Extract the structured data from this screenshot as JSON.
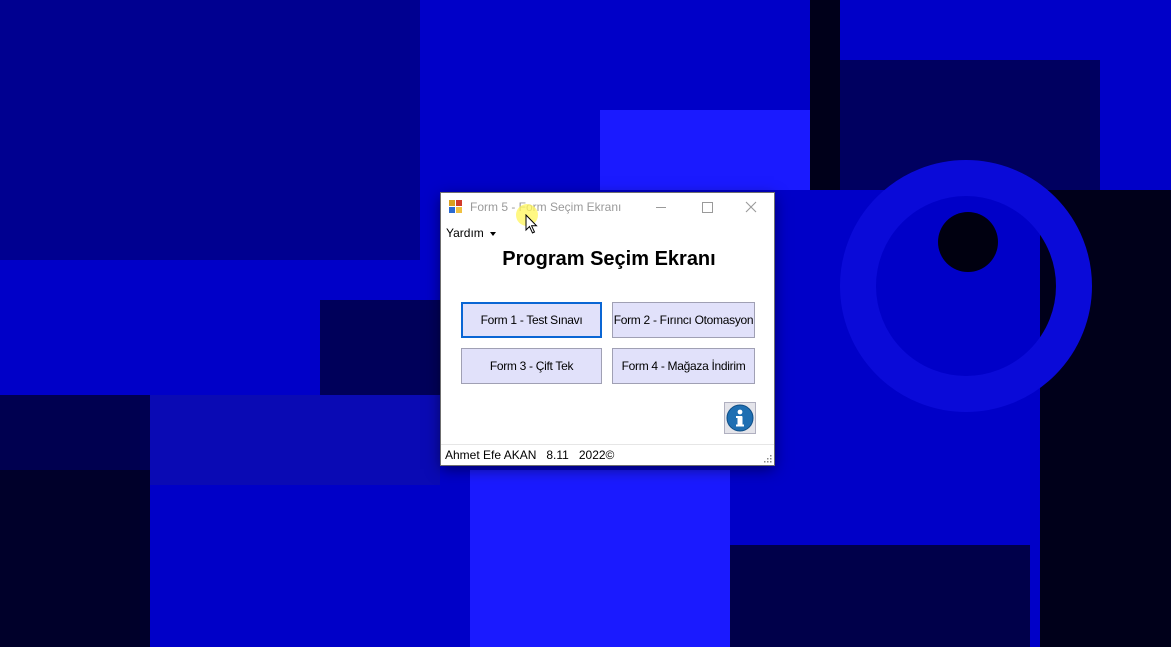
{
  "window": {
    "title": "Form 5 - Form Seçim Ekranı",
    "menu_help_label": "Yardım",
    "heading": "Program Seçim Ekranı",
    "buttons": [
      {
        "label": "Form 1 - Test Sınavı"
      },
      {
        "label": "Form 2 - Fırıncı Otomasyon"
      },
      {
        "label": "Form 3 - Çift Tek"
      },
      {
        "label": "Form 4 - Mağaza İndirim"
      }
    ],
    "info_icon": "info-icon",
    "status_text": "Ahmet Efe AKAN   8.11   2022©"
  },
  "colors": {
    "desktop_background": "#0000c8",
    "button_background": "#e1e1fa",
    "focus_border": "#0a66d4",
    "info_icon": "#1f6fb2"
  },
  "icons": {
    "app": "app-icon",
    "minimize": "minimize-icon",
    "maximize": "maximize-icon",
    "close": "close-icon",
    "help_dropdown": "chevron-down-icon",
    "info": "info-icon",
    "resize_grip": "resize-grip-icon",
    "cursor": "mouse-cursor-icon"
  }
}
